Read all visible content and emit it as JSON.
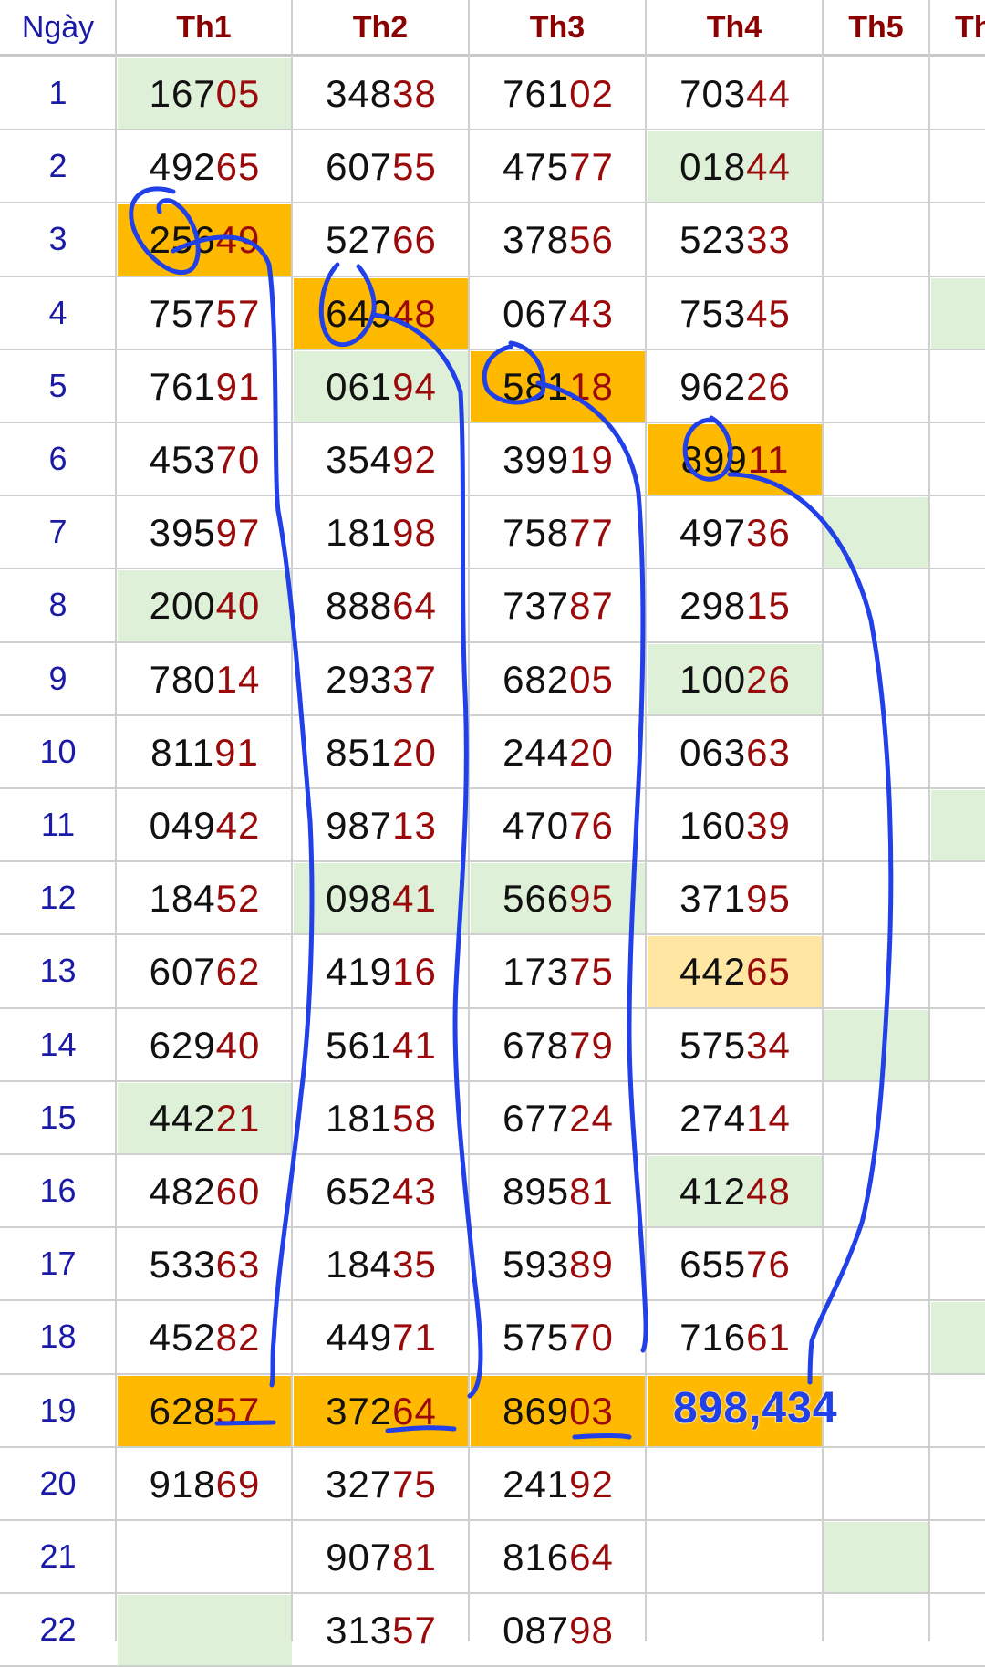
{
  "headers": [
    "Ngày",
    "Th1",
    "Th2",
    "Th3",
    "Th4",
    "Th5",
    "Th"
  ],
  "rows": [
    {
      "day": "1",
      "values": [
        "16705",
        "34838",
        "76102",
        "70344",
        "",
        ""
      ]
    },
    {
      "day": "2",
      "values": [
        "49265",
        "60755",
        "47577",
        "01844",
        "",
        ""
      ]
    },
    {
      "day": "3",
      "values": [
        "25649",
        "52766",
        "37856",
        "52333",
        "",
        ""
      ]
    },
    {
      "day": "4",
      "values": [
        "75757",
        "64948",
        "06743",
        "75345",
        "",
        ""
      ]
    },
    {
      "day": "5",
      "values": [
        "76191",
        "06194",
        "58118",
        "96226",
        "",
        ""
      ]
    },
    {
      "day": "6",
      "values": [
        "45370",
        "35492",
        "39919",
        "89911",
        "",
        ""
      ]
    },
    {
      "day": "7",
      "values": [
        "39597",
        "18198",
        "75877",
        "49736",
        "",
        ""
      ]
    },
    {
      "day": "8",
      "values": [
        "20040",
        "88864",
        "73787",
        "29815",
        "",
        ""
      ]
    },
    {
      "day": "9",
      "values": [
        "78014",
        "29337",
        "68205",
        "10026",
        "",
        ""
      ]
    },
    {
      "day": "10",
      "values": [
        "81191",
        "85120",
        "24420",
        "06363",
        "",
        ""
      ]
    },
    {
      "day": "11",
      "values": [
        "04942",
        "98713",
        "47076",
        "16039",
        "",
        ""
      ]
    },
    {
      "day": "12",
      "values": [
        "18452",
        "09841",
        "56695",
        "37195",
        "",
        ""
      ]
    },
    {
      "day": "13",
      "values": [
        "60762",
        "41916",
        "17375",
        "44265",
        "",
        ""
      ]
    },
    {
      "day": "14",
      "values": [
        "62940",
        "56141",
        "67879",
        "57534",
        "",
        ""
      ]
    },
    {
      "day": "15",
      "values": [
        "44221",
        "18158",
        "67724",
        "27414",
        "",
        ""
      ]
    },
    {
      "day": "16",
      "values": [
        "48260",
        "65243",
        "89581",
        "41248",
        "",
        ""
      ]
    },
    {
      "day": "17",
      "values": [
        "53363",
        "18435",
        "59389",
        "65576",
        "",
        ""
      ]
    },
    {
      "day": "18",
      "values": [
        "45282",
        "44971",
        "57570",
        "71661",
        "",
        ""
      ]
    },
    {
      "day": "19",
      "values": [
        "62857",
        "37264",
        "86903",
        "",
        "",
        ""
      ]
    },
    {
      "day": "20",
      "values": [
        "91869",
        "32775",
        "24192",
        "",
        "",
        ""
      ]
    },
    {
      "day": "21",
      "values": [
        "",
        "90781",
        "81664",
        "",
        "",
        ""
      ]
    },
    {
      "day": "22",
      "values": [
        "",
        "31357",
        "08798",
        "",
        "",
        ""
      ]
    }
  ],
  "highlights": {
    "orange": [
      [
        3,
        1
      ],
      [
        4,
        2
      ],
      [
        5,
        3
      ],
      [
        6,
        4
      ],
      [
        19,
        1
      ],
      [
        19,
        2
      ],
      [
        19,
        3
      ],
      [
        19,
        4
      ]
    ],
    "light_orange": [
      [
        13,
        4
      ]
    ],
    "green": [
      [
        1,
        1
      ],
      [
        2,
        4
      ],
      [
        4,
        6
      ],
      [
        5,
        2
      ],
      [
        7,
        5
      ],
      [
        8,
        1
      ],
      [
        9,
        4
      ],
      [
        11,
        6
      ],
      [
        12,
        2
      ],
      [
        12,
        3
      ],
      [
        14,
        5
      ],
      [
        15,
        1
      ],
      [
        16,
        4
      ],
      [
        18,
        6
      ],
      [
        21,
        5
      ],
      [
        22,
        1
      ]
    ]
  },
  "colors": {
    "orange": "#ffb900",
    "light_orange": "#ffe6a3",
    "green": "#dff0d8",
    "header_text": "#8b0000",
    "day_text": "#1a1aa6",
    "tail_digits": "#9b0a0a",
    "annotation": "#2140e8"
  },
  "annotation_note": "898,434"
}
